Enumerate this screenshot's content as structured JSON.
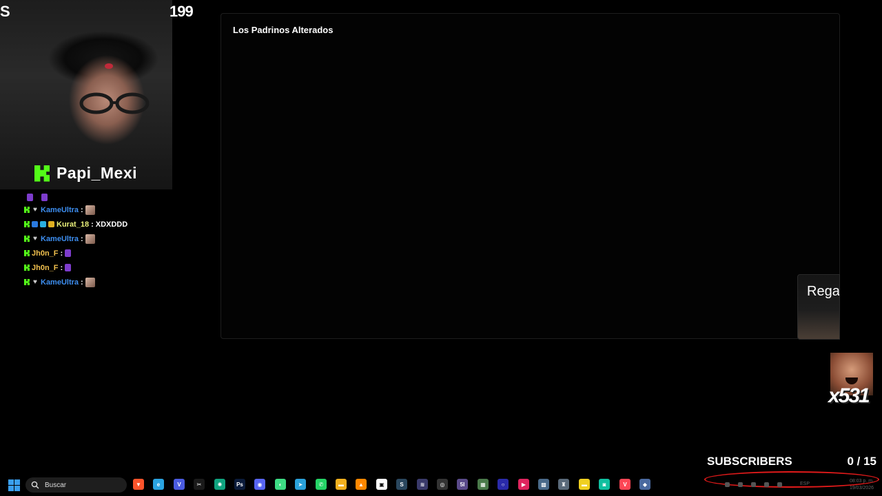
{
  "overlay": {
    "left_text": "S",
    "right_text": "199"
  },
  "streamer": {
    "name": "Papi_Mexi",
    "logo_icon": "kick-logo-icon",
    "brand_color": "#53fc18"
  },
  "chat": {
    "messages": [
      {
        "user": "KameUltra",
        "separator": ":",
        "text": "",
        "user_color": "#3d8ef0"
      },
      {
        "user": "Kurat_18",
        "separator": ":",
        "text": "XDXDDD",
        "user_color": "#e9f07a"
      },
      {
        "user": "KameUltra",
        "separator": ":",
        "text": "",
        "user_color": "#3d8ef0"
      },
      {
        "user": "Jh0n_F",
        "separator": ":",
        "text": "",
        "user_color": "#f2c14e"
      },
      {
        "user": "Jh0n_F",
        "separator": ":",
        "text": "",
        "user_color": "#f2c14e"
      },
      {
        "user": "KameUltra",
        "separator": ":",
        "text": "",
        "user_color": "#3d8ef0"
      }
    ]
  },
  "panel": {
    "title": "Los Padrinos Alterados",
    "side_card_label": "Rega"
  },
  "emote_counter": {
    "count": "x531"
  },
  "subscribers": {
    "label": "SUBSCRIBERS",
    "count": "0  / 15"
  },
  "taskbar": {
    "search_placeholder": "Buscar",
    "language": "ESP",
    "time": "08:03 p. m.",
    "date": "19/03/2026",
    "tray_highlight_color": "#e11a1a",
    "apps": [
      {
        "icon": "brave-browser-icon",
        "color": "#fb542b",
        "glyph": "▼"
      },
      {
        "icon": "edge-browser-icon",
        "color": "#2aa3e0",
        "glyph": "e"
      },
      {
        "icon": "vivaldi-icon",
        "color": "#4a5be0",
        "glyph": "V"
      },
      {
        "icon": "capcut-icon",
        "color": "#1a1a1a",
        "glyph": "✂"
      },
      {
        "icon": "chatgpt-icon",
        "color": "#10a37f",
        "glyph": "✺"
      },
      {
        "icon": "photoshop-icon",
        "color": "#0b1b3a",
        "glyph": "Ps"
      },
      {
        "icon": "discord-icon",
        "color": "#5865f2",
        "glyph": "◉"
      },
      {
        "icon": "android-icon",
        "color": "#3ddc84",
        "glyph": "◐"
      },
      {
        "icon": "telegram-icon",
        "color": "#2aa1da",
        "glyph": "➤"
      },
      {
        "icon": "whatsapp-icon",
        "color": "#25d366",
        "glyph": "✆"
      },
      {
        "icon": "file-explorer-icon",
        "color": "#f2b01e",
        "glyph": "▬"
      },
      {
        "icon": "vlc-icon",
        "color": "#ff8800",
        "glyph": "▲"
      },
      {
        "icon": "store-icon",
        "color": "#ffffff",
        "glyph": "▣"
      },
      {
        "icon": "steam-icon",
        "color": "#2a475e",
        "glyph": "S"
      },
      {
        "icon": "soundwave-icon",
        "color": "#3a3a6a",
        "glyph": "≋"
      },
      {
        "icon": "obs-icon",
        "color": "#333333",
        "glyph": "◎"
      },
      {
        "icon": "streamlabs-icon",
        "color": "#5a4a8a",
        "glyph": "5I"
      },
      {
        "icon": "mosaic-icon",
        "color": "#4a7a4a",
        "glyph": "▦"
      },
      {
        "icon": "cortana-icon",
        "color": "#2a2aaa",
        "glyph": "○"
      },
      {
        "icon": "media-player-icon",
        "color": "#e0245e",
        "glyph": "▶"
      },
      {
        "icon": "game-icon",
        "color": "#4a6a8a",
        "glyph": "▩"
      },
      {
        "icon": "game2-icon",
        "color": "#5a6a7a",
        "glyph": "♜"
      },
      {
        "icon": "sticky-notes-icon",
        "color": "#f0d020",
        "glyph": "▬"
      },
      {
        "icon": "chat-app-icon",
        "color": "#10c0a0",
        "glyph": "◙"
      },
      {
        "icon": "valorant-icon",
        "color": "#ff4655",
        "glyph": "V"
      },
      {
        "icon": "network-app-icon",
        "color": "#4a6aa0",
        "glyph": "◆"
      }
    ]
  }
}
